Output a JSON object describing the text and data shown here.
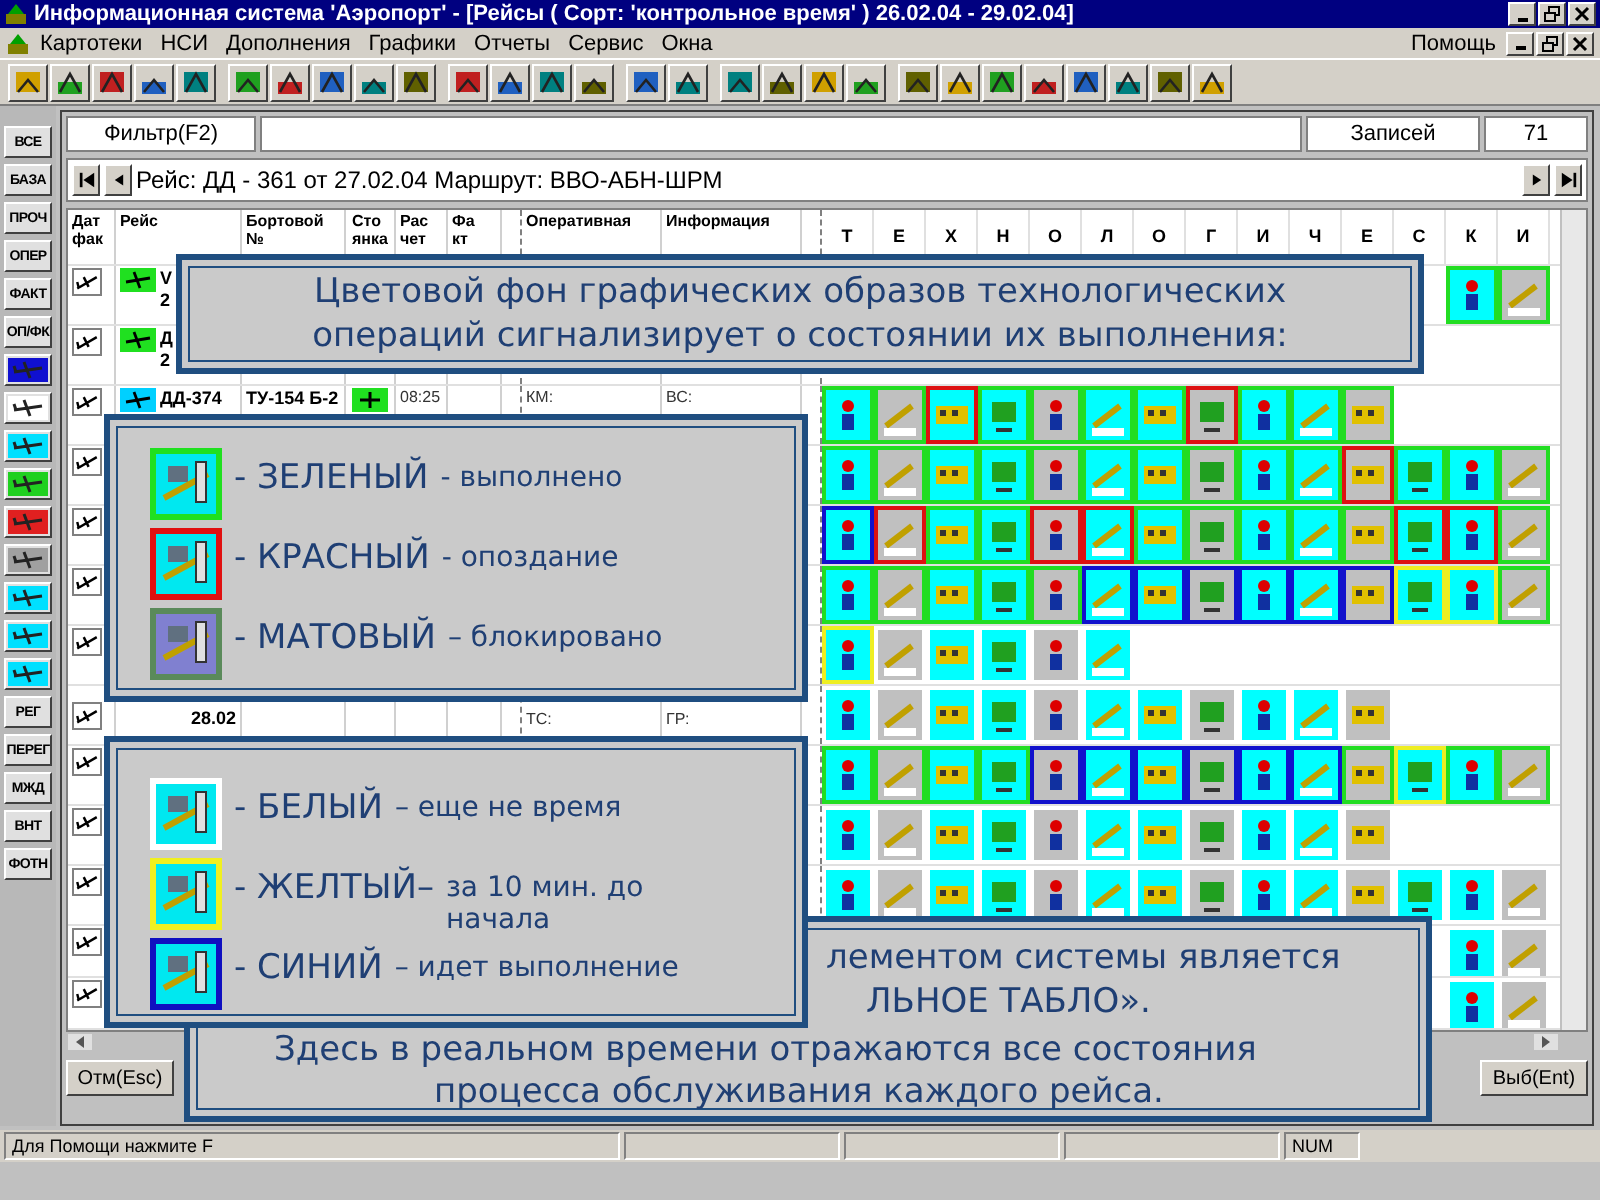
{
  "window": {
    "title": "Информационная система 'Аэропорт' - [Рейсы ( Сорт: 'контрольное время' ) 26.02.04 - 29.02.04]"
  },
  "menu": [
    "Картотеки",
    "НСИ",
    "Дополнения",
    "Графики",
    "Отчеты",
    "Сервис",
    "Окна"
  ],
  "help_menu": "Помощь",
  "left_toolbar": [
    {
      "kind": "text",
      "label": "ВСЕ"
    },
    {
      "kind": "text",
      "label": "БАЗА"
    },
    {
      "kind": "text",
      "label": "ПРОЧ"
    },
    {
      "kind": "text",
      "label": "ОПЕР"
    },
    {
      "kind": "text",
      "label": "ФАКТ"
    },
    {
      "kind": "text",
      "label": "ОП/ФК"
    },
    {
      "kind": "icon",
      "color": "#1010d0"
    },
    {
      "kind": "icon",
      "color": "#ffffff"
    },
    {
      "kind": "icon",
      "color": "#00e0ff"
    },
    {
      "kind": "icon",
      "color": "#20d020"
    },
    {
      "kind": "icon",
      "color": "#e02020"
    },
    {
      "kind": "icon",
      "color": "#a0a0a0"
    },
    {
      "kind": "icon",
      "color": "#00e0ff"
    },
    {
      "kind": "icon",
      "color": "#00e0ff"
    },
    {
      "kind": "icon",
      "color": "#00e0ff"
    },
    {
      "kind": "text",
      "label": "РЕГ"
    },
    {
      "kind": "text",
      "label": "ПЕРЕГ"
    },
    {
      "kind": "text",
      "label": "МЖД"
    },
    {
      "kind": "text",
      "label": "ВНТ"
    },
    {
      "kind": "text",
      "label": "ФОТН"
    }
  ],
  "filter": {
    "button": "Фильтр(F2)",
    "count_label": "Записей",
    "count": "71"
  },
  "nav": {
    "text": "Рейс: ДД - 361 от 27.02.04 Маршрут: ВВО-АБН-ШРМ"
  },
  "table": {
    "columns": [
      {
        "lines": [
          "Дат",
          "фак"
        ]
      },
      {
        "lines": [
          "Рейс"
        ]
      },
      {
        "lines": [
          "Бортовой",
          "№"
        ]
      },
      {
        "lines": [
          "Сто",
          "янка"
        ]
      },
      {
        "lines": [
          "Рас",
          "чет"
        ]
      },
      {
        "lines": [
          "Фа",
          "кт"
        ]
      },
      {
        "lines": [
          "Оперативная"
        ]
      },
      {
        "lines": [
          "Информация"
        ]
      }
    ],
    "letters": [
      "Т",
      "Е",
      "Х",
      "Н",
      "О",
      "Л",
      "О",
      "Г",
      "И",
      "Ч",
      "Е",
      "С",
      "К",
      "И"
    ],
    "rows": [
      {
        "flight": "V",
        "date": "2",
        "color": "#20e020",
        "right_aligned": true,
        "tiles": [
          {
            "color": "#22dd22"
          },
          {
            "color": "#22dd22"
          }
        ]
      },
      {
        "flight": "Д",
        "date": "2",
        "color": "#20e020"
      },
      {
        "flight": "ДД-374",
        "aircraft": "ТУ-154 Б-2",
        "stand": true,
        "calc": "08:25",
        "oper": [
          "КМ:"
        ],
        "info": [
          "ВС:"
        ],
        "color": "#00d0ff",
        "tiles": [
          {
            "color": "#22dd22"
          },
          {
            "color": "#22dd22"
          },
          {
            "color": "#dd1111"
          },
          {
            "color": "#22dd22"
          },
          {
            "color": "#22dd22"
          },
          {
            "color": "#22dd22"
          },
          {
            "color": "#22dd22"
          },
          {
            "color": "#dd1111"
          },
          {
            "color": "#22dd22"
          },
          {
            "color": "#22dd22"
          },
          {
            "color": "#22dd22"
          }
        ]
      },
      {
        "tiles": [
          {
            "color": "#22dd22"
          },
          {
            "color": "#22dd22"
          },
          {
            "color": "#22dd22"
          },
          {
            "color": "#22dd22"
          },
          {
            "color": "#22dd22"
          },
          {
            "color": "#22dd22"
          },
          {
            "color": "#22dd22"
          },
          {
            "color": "#22dd22"
          },
          {
            "color": "#22dd22"
          },
          {
            "color": "#22dd22"
          },
          {
            "color": "#dd1111"
          },
          {
            "color": "#22dd22"
          },
          {
            "color": "#22dd22"
          },
          {
            "color": "#22dd22"
          }
        ]
      },
      {
        "tiles": [
          {
            "color": "#1111cc"
          },
          {
            "color": "#dd1111"
          },
          {
            "color": "#22dd22"
          },
          {
            "color": "#22dd22"
          },
          {
            "color": "#dd1111"
          },
          {
            "color": "#dd1111"
          },
          {
            "color": "#22dd22"
          },
          {
            "color": "#22dd22"
          },
          {
            "color": "#22dd22"
          },
          {
            "color": "#22dd22"
          },
          {
            "color": "#22dd22"
          },
          {
            "color": "#dd1111"
          },
          {
            "color": "#dd1111"
          },
          {
            "color": "#22dd22"
          }
        ]
      },
      {
        "tiles": [
          {
            "color": "#22dd22"
          },
          {
            "color": "#22dd22"
          },
          {
            "color": "#22dd22"
          },
          {
            "color": "#22dd22"
          },
          {
            "color": "#22dd22"
          },
          {
            "color": "#1111cc"
          },
          {
            "color": "#1111cc"
          },
          {
            "color": "#1111cc"
          },
          {
            "color": "#1111cc"
          },
          {
            "color": "#1111cc"
          },
          {
            "color": "#1111cc"
          },
          {
            "color": "#eeee22"
          },
          {
            "color": "#eeee22"
          },
          {
            "color": "#22dd22"
          }
        ]
      },
      {
        "tiles": [
          {
            "color": "#eeee22"
          },
          {
            "color": "#ffffff"
          },
          {
            "color": "#ffffff"
          },
          {
            "color": "#ffffff"
          },
          {
            "color": "#ffffff"
          },
          {
            "color": "#ffffff"
          }
        ]
      },
      {
        "date": "28.02",
        "oper": [
          "ТС:"
        ],
        "info": [
          "ГР:"
        ],
        "tiles": [
          {
            "color": "#ffffff"
          },
          {
            "color": "#ffffff"
          },
          {
            "color": "#ffffff"
          },
          {
            "color": "#ffffff"
          },
          {
            "color": "#ffffff"
          },
          {
            "color": "#ffffff"
          },
          {
            "color": "#ffffff"
          },
          {
            "color": "#ffffff"
          },
          {
            "color": "#ffffff"
          },
          {
            "color": "#ffffff"
          },
          {
            "color": "#ffffff"
          }
        ]
      },
      {
        "tiles": [
          {
            "color": "#22dd22"
          },
          {
            "color": "#22dd22"
          },
          {
            "color": "#22dd22"
          },
          {
            "color": "#22dd22"
          },
          {
            "color": "#1111cc"
          },
          {
            "color": "#1111cc"
          },
          {
            "color": "#1111cc"
          },
          {
            "color": "#1111cc"
          },
          {
            "color": "#1111cc"
          },
          {
            "color": "#1111cc"
          },
          {
            "color": "#22dd22"
          },
          {
            "color": "#eeee22"
          },
          {
            "color": "#22dd22"
          },
          {
            "color": "#22dd22"
          }
        ]
      },
      {
        "tiles": [
          {
            "color": "#ffffff"
          },
          {
            "color": "#ffffff"
          },
          {
            "color": "#ffffff"
          },
          {
            "color": "#ffffff"
          },
          {
            "color": "#ffffff"
          },
          {
            "color": "#ffffff"
          },
          {
            "color": "#ffffff"
          },
          {
            "color": "#ffffff"
          },
          {
            "color": "#ffffff"
          },
          {
            "color": "#ffffff"
          },
          {
            "color": "#ffffff"
          }
        ]
      },
      {
        "tiles": [
          {
            "color": "#ffffff"
          },
          {
            "color": "#ffffff"
          },
          {
            "color": "#ffffff"
          },
          {
            "color": "#ffffff"
          },
          {
            "color": "#ffffff"
          },
          {
            "color": "#ffffff"
          },
          {
            "color": "#ffffff"
          },
          {
            "color": "#ffffff"
          },
          {
            "color": "#ffffff"
          },
          {
            "color": "#ffffff"
          },
          {
            "color": "#ffffff"
          },
          {
            "color": "#ffffff"
          },
          {
            "color": "#ffffff"
          },
          {
            "color": "#ffffff"
          }
        ]
      },
      {
        "right_aligned": true,
        "tiles": [
          {
            "color": "#ffffff"
          },
          {
            "color": "#ffffff"
          }
        ]
      },
      {
        "right_aligned": true,
        "tiles": [
          {
            "color": "#ffffff"
          },
          {
            "color": "#ffffff"
          }
        ]
      }
    ]
  },
  "buttons": [
    "Отм(Esc)",
    "Выб(Ent)"
  ],
  "status_bar": {
    "help": "Для Помощи нажмите F",
    "num": "NUM"
  },
  "banner": [
    "Цветовой фон графических образов технологических",
    "операций сигнализирует о состоянии их выполнения:"
  ],
  "legends": [
    [
      {
        "color": "#20e020",
        "name": "- ЗЕЛЕНЫЙ",
        "desc": "- выполнено"
      },
      {
        "color": "#e01010",
        "name": "- КРАСНЫЙ",
        "desc": "- опоздание"
      },
      {
        "color": "#5a8a5a",
        "name": "- МАТОВЫЙ",
        "desc": "– блокировано"
      }
    ],
    [
      {
        "color": "#ffffff",
        "name": "- БЕЛЫЙ",
        "desc": "– еще не время"
      },
      {
        "color": "#f0f020",
        "name": "- ЖЕЛТЫЙ–",
        "desc": "за 10 мин. до начала"
      },
      {
        "color": "#1010c0",
        "name": "- СИНИЙ",
        "desc": "– идет выполнение"
      }
    ]
  ],
  "note": [
    "лементом системы является",
    "ЛЬНОЕ ТАБЛО».",
    "Здесь в реальном времени отражаются все состояния",
    "процесса обслуживания каждого рейса."
  ]
}
